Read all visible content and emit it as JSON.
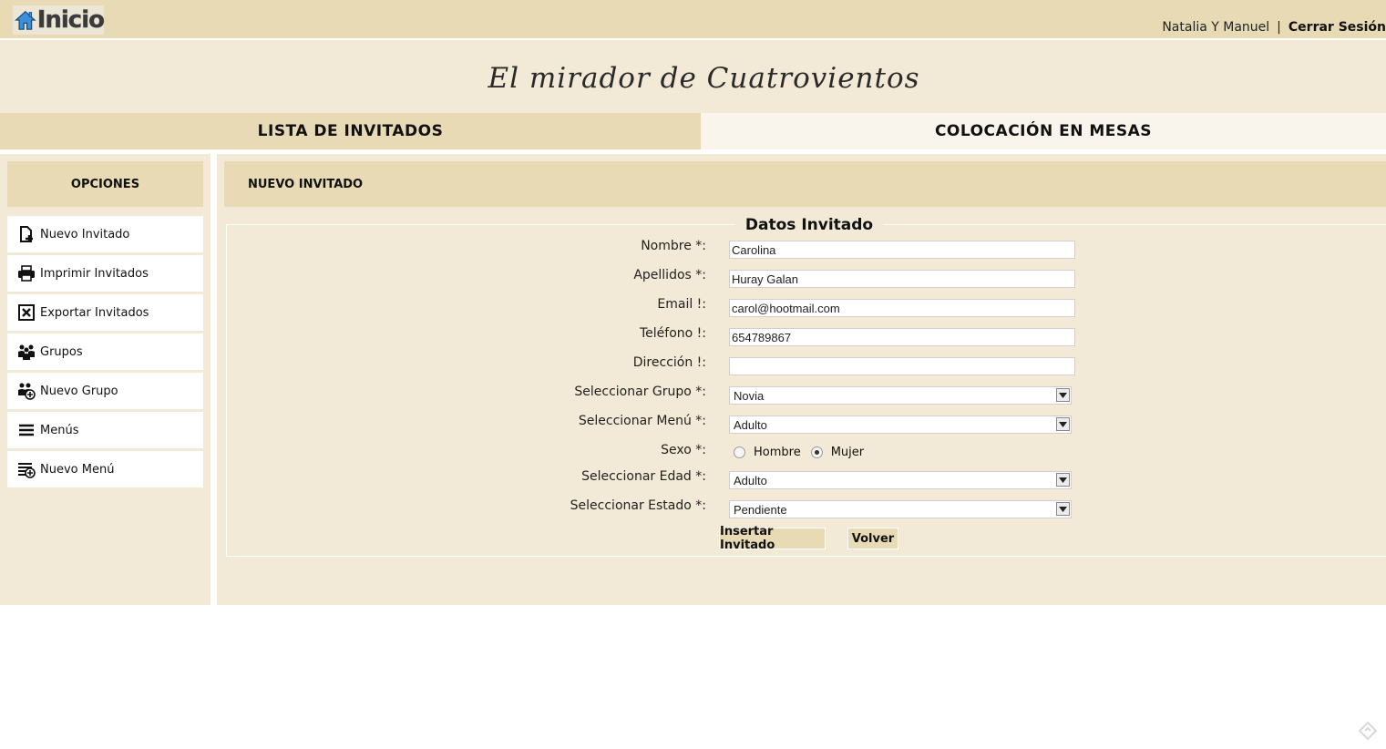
{
  "header": {
    "home_label": "Inicio",
    "user_name": "Natalia Y Manuel",
    "separator": "|",
    "logout_label": "Cerrar Sesión"
  },
  "banner": {
    "title": "El mirador de Cuatrovientos"
  },
  "tabs": [
    {
      "label": "LISTA DE INVITADOS",
      "active": true
    },
    {
      "label": "COLOCACIÓN EN MESAS",
      "active": false
    }
  ],
  "sidebar": {
    "title": "OPCIONES",
    "items": [
      {
        "label": "Nuevo Invitado",
        "icon": "new-document-icon"
      },
      {
        "label": "Imprimir Invitados",
        "icon": "printer-icon"
      },
      {
        "label": "Exportar Invitados",
        "icon": "excel-export-icon"
      },
      {
        "label": "Grupos",
        "icon": "group-icon"
      },
      {
        "label": "Nuevo Grupo",
        "icon": "add-group-icon"
      },
      {
        "label": "Menús",
        "icon": "menu-list-icon"
      },
      {
        "label": "Nuevo Menú",
        "icon": "add-menu-icon"
      }
    ]
  },
  "main": {
    "section_title": "NUEVO INVITADO",
    "form_title": "Datos Invitado",
    "fields": {
      "nombre": {
        "label": "Nombre *:",
        "value": "Carolina"
      },
      "apellidos": {
        "label": "Apellidos *:",
        "value": "Huray Galan"
      },
      "email": {
        "label": "Email !:",
        "value": "carol@hootmail.com"
      },
      "telefono": {
        "label": "Teléfono !:",
        "value": "654789867"
      },
      "direccion": {
        "label": "Dirección !:",
        "value": ""
      },
      "grupo": {
        "label": "Seleccionar Grupo *:",
        "value": "Novia"
      },
      "menu": {
        "label": "Seleccionar Menú *:",
        "value": "Adulto"
      },
      "sexo": {
        "label": "Sexo *:",
        "option_male": "Hombre",
        "option_female": "Mujer",
        "selected": "Mujer"
      },
      "edad": {
        "label": "Seleccionar Edad *:",
        "value": "Adulto"
      },
      "estado": {
        "label": "Seleccionar Estado *:",
        "value": "Pendiente"
      }
    },
    "buttons": {
      "insert": "Insertar Invitado",
      "back": "Volver"
    }
  },
  "colors": {
    "tan": "#e8dab5",
    "cream": "#f2ead6",
    "home_icon": "#3a8fd9"
  }
}
